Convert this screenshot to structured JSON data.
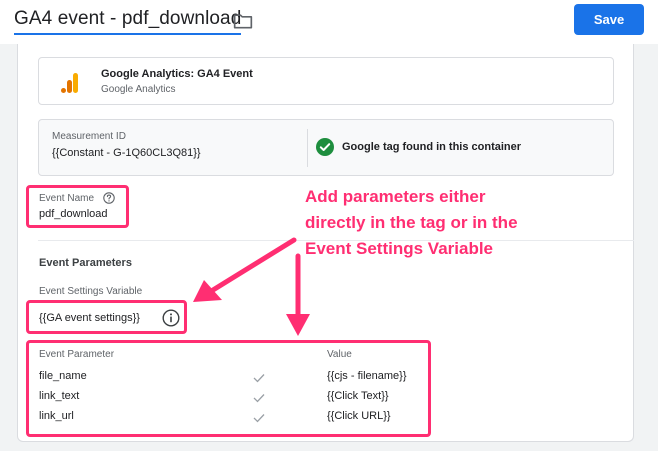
{
  "header": {
    "tag_title": "GA4 event - pdf_download",
    "save_label": "Save",
    "folder_icon": "folder-icon"
  },
  "tag_type": {
    "name": "Google Analytics: GA4 Event",
    "vendor": "Google Analytics",
    "icon": "google-analytics-logo"
  },
  "measurement": {
    "label": "Measurement ID",
    "value": "{{Constant - G-1Q60CL3Q81}}",
    "status_text": "Google tag found in this container",
    "status_icon": "check-circle-icon"
  },
  "event_name": {
    "label": "Event Name",
    "value": "pdf_download",
    "help_icon": "help-circle-icon"
  },
  "event_parameters": {
    "section_title": "Event Parameters",
    "settings_label": "Event Settings Variable",
    "settings_value": "{{GA event settings}}",
    "info_icon": "info-icon",
    "columns": [
      "Event Parameter",
      "Value"
    ],
    "rows": [
      {
        "parameter": "file_name",
        "value": "{{cjs - filename}}"
      },
      {
        "parameter": "link_text",
        "value": "{{Click Text}}"
      },
      {
        "parameter": "link_url",
        "value": "{{Click URL}}"
      }
    ]
  },
  "annotation": {
    "lines": [
      "Add parameters either",
      "directly in the tag or in the",
      "Event Settings Variable"
    ],
    "color": "#ff2e72"
  },
  "colors": {
    "primary": "#1a73e8",
    "success": "#1e8e3e",
    "annotation": "#ff2e72"
  }
}
